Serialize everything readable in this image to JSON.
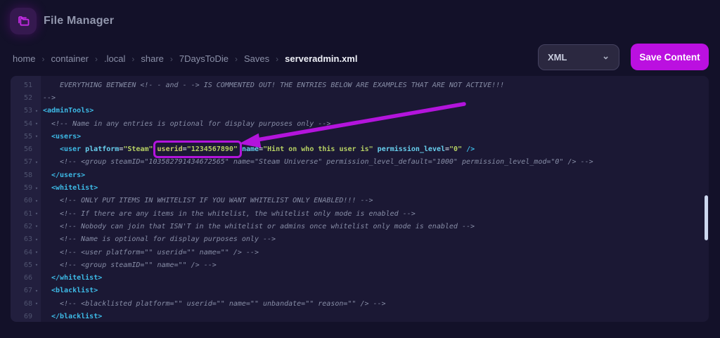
{
  "colors": {
    "accent": "#b314dc",
    "button_bg": "#bb10e0",
    "page_bg": "#131129",
    "editor_bg": "#1b1834",
    "gutter_bg": "#221f3e",
    "tag": "#3dbae6",
    "attribute": "#67cfee",
    "value": "#b6d063",
    "comment": "#878da6",
    "line_number": "#4f536f",
    "highlighted_attr": "#c9cf68",
    "scroll_thumb": "#ccd7ee"
  },
  "header": {
    "title": "File Manager",
    "icon": "folder-icon"
  },
  "breadcrumb": {
    "separator": "›",
    "items": [
      "home",
      "container",
      ".local",
      "share",
      "7DaysToDie",
      "Saves",
      "serveradmin.xml"
    ]
  },
  "toolbar": {
    "file_type_label": "XML",
    "save_label": "Save Content"
  },
  "annotation": {
    "highlighted_text": "userid=\"1234567890\"",
    "style": "magenta box with arrow pointing at it"
  },
  "editor": {
    "language": "xml",
    "first_line": 51,
    "last_line": 69,
    "lines": [
      {
        "num": 51,
        "fold": false,
        "indent": 2,
        "tokens": [
          {
            "t": "comment",
            "s": "EVERYTHING BETWEEN <!- - and - -> IS COMMENTED OUT! THE ENTRIES BELOW ARE EXAMPLES THAT ARE NOT ACTIVE!!!"
          }
        ]
      },
      {
        "num": 52,
        "fold": false,
        "indent": 0,
        "tokens": [
          {
            "t": "comment",
            "s": "-->"
          }
        ]
      },
      {
        "num": 53,
        "fold": true,
        "indent": 0,
        "tokens": [
          {
            "t": "tag",
            "s": "<adminTools>"
          }
        ]
      },
      {
        "num": 54,
        "fold": true,
        "indent": 1,
        "tokens": [
          {
            "t": "comment",
            "s": "<!-- Name in any entries is optional for display purposes only -->"
          }
        ]
      },
      {
        "num": 55,
        "fold": true,
        "indent": 1,
        "tokens": [
          {
            "t": "tag",
            "s": "<users>"
          }
        ]
      },
      {
        "num": 56,
        "fold": false,
        "indent": 2,
        "tokens": [
          {
            "t": "tag",
            "s": "<user"
          },
          {
            "t": "eq",
            "s": " "
          },
          {
            "t": "attr",
            "s": "platform"
          },
          {
            "t": "eq",
            "s": "="
          },
          {
            "t": "val",
            "s": "\"Steam\""
          },
          {
            "t": "eq",
            "s": " "
          },
          {
            "t": "box",
            "tokens": [
              {
                "t": "hlattr",
                "s": "userid"
              },
              {
                "t": "eq",
                "s": "="
              },
              {
                "t": "val",
                "s": "\"1234567890\""
              }
            ]
          },
          {
            "t": "eq",
            "s": " "
          },
          {
            "t": "attr",
            "s": "name"
          },
          {
            "t": "eq",
            "s": "="
          },
          {
            "t": "val",
            "s": "\"Hint on who this user is\""
          },
          {
            "t": "eq",
            "s": " "
          },
          {
            "t": "attr",
            "s": "permission_level"
          },
          {
            "t": "eq",
            "s": "="
          },
          {
            "t": "val",
            "s": "\"0\""
          },
          {
            "t": "tag",
            "s": " />"
          }
        ]
      },
      {
        "num": 57,
        "fold": true,
        "indent": 2,
        "tokens": [
          {
            "t": "comment",
            "s": "<!-- <group steamID=\"103582791434672565\" name=\"Steam Universe\" permission_level_default=\"1000\" permission_level_mod=\"0\" /> -->"
          }
        ]
      },
      {
        "num": 58,
        "fold": false,
        "indent": 1,
        "tokens": [
          {
            "t": "tag",
            "s": "</users>"
          }
        ]
      },
      {
        "num": 59,
        "fold": true,
        "indent": 1,
        "tokens": [
          {
            "t": "tag",
            "s": "<whitelist>"
          }
        ]
      },
      {
        "num": 60,
        "fold": true,
        "indent": 2,
        "tokens": [
          {
            "t": "comment",
            "s": "<!-- ONLY PUT ITEMS IN WHITELIST IF YOU WANT WHITELIST ONLY ENABLED!!! -->"
          }
        ]
      },
      {
        "num": 61,
        "fold": true,
        "indent": 2,
        "tokens": [
          {
            "t": "comment",
            "s": "<!-- If there are any items in the whitelist, the whitelist only mode is enabled -->"
          }
        ]
      },
      {
        "num": 62,
        "fold": true,
        "indent": 2,
        "tokens": [
          {
            "t": "comment",
            "s": "<!-- Nobody can join that ISN'T in the whitelist or admins once whitelist only mode is enabled -->"
          }
        ]
      },
      {
        "num": 63,
        "fold": true,
        "indent": 2,
        "tokens": [
          {
            "t": "comment",
            "s": "<!-- Name is optional for display purposes only -->"
          }
        ]
      },
      {
        "num": 64,
        "fold": true,
        "indent": 2,
        "tokens": [
          {
            "t": "comment",
            "s": "<!-- <user platform=\"\" userid=\"\" name=\"\" /> -->"
          }
        ]
      },
      {
        "num": 65,
        "fold": true,
        "indent": 2,
        "tokens": [
          {
            "t": "comment",
            "s": "<!-- <group steamID=\"\" name=\"\" /> -->"
          }
        ]
      },
      {
        "num": 66,
        "fold": false,
        "indent": 1,
        "tokens": [
          {
            "t": "tag",
            "s": "</whitelist>"
          }
        ]
      },
      {
        "num": 67,
        "fold": true,
        "indent": 1,
        "tokens": [
          {
            "t": "tag",
            "s": "<blacklist>"
          }
        ]
      },
      {
        "num": 68,
        "fold": true,
        "indent": 2,
        "tokens": [
          {
            "t": "comment",
            "s": "<!-- <blacklisted platform=\"\" userid=\"\" name=\"\" unbandate=\"\" reason=\"\" /> -->"
          }
        ]
      },
      {
        "num": 69,
        "fold": false,
        "indent": 1,
        "tokens": [
          {
            "t": "tag",
            "s": "</blacklist>"
          }
        ]
      }
    ]
  }
}
